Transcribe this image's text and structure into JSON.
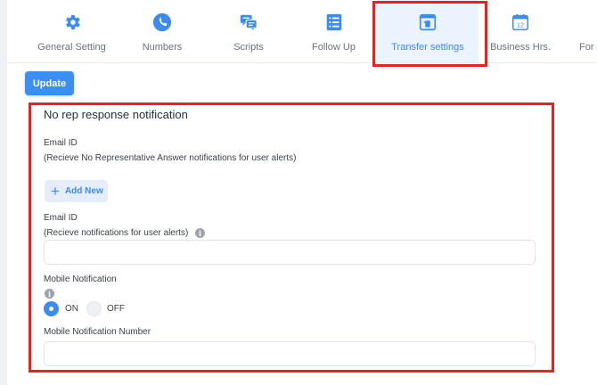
{
  "tabs": [
    {
      "label": "General Setting",
      "icon": "gear-icon",
      "active": false
    },
    {
      "label": "Numbers",
      "icon": "phone-icon",
      "active": false
    },
    {
      "label": "Scripts",
      "icon": "chat-bubbles-icon",
      "active": false
    },
    {
      "label": "Follow Up",
      "icon": "list-icon",
      "active": false
    },
    {
      "label": "Transfer settings",
      "icon": "transfer-window-icon",
      "active": true
    },
    {
      "label": "Business Hrs.",
      "icon": "calendar-icon",
      "active": false
    },
    {
      "label": "For",
      "icon": "",
      "active": false
    }
  ],
  "calendar_day": "12",
  "toolbar": {
    "update_label": "Update"
  },
  "section": {
    "title": "No rep response notification",
    "email1_label": "Email ID",
    "email1_hint": "(Recieve No Representative Answer notifications for user alerts)",
    "add_new_label": "Add New",
    "add_new_symbol": "+",
    "email2_label": "Email ID",
    "email2_hint": "(Recieve notifications for user alerts)",
    "email2_value": "",
    "mobile_label": "Mobile Notification",
    "mobile_on_label": "ON",
    "mobile_off_label": "OFF",
    "mobile_selected": "ON",
    "mobile_number_label": "Mobile Notification Number",
    "mobile_number_value": "",
    "info_glyph": "i"
  },
  "colors": {
    "accent": "#3c8cef",
    "highlight": "#e8231c",
    "button": "#3b8ff0"
  }
}
